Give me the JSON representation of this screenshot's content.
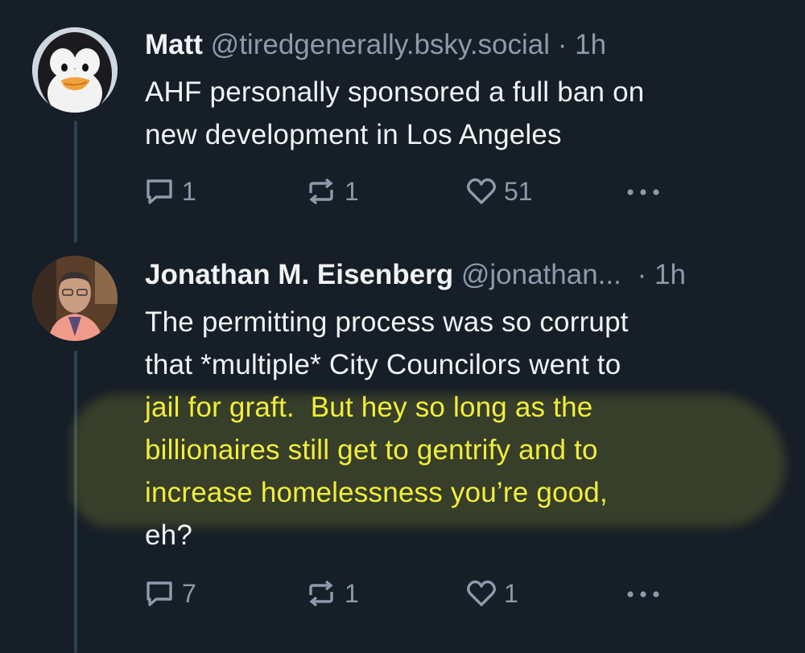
{
  "posts": [
    {
      "author_name": "Matt",
      "handle": "@tiredgenerally.bsky.social",
      "separator": "·",
      "time": "1h",
      "text_lines": [
        "AHF personally sponsored a full ban on",
        "new development in Los Angeles"
      ],
      "replies": "1",
      "reposts": "1",
      "likes": "51"
    },
    {
      "author_name": "Jonathan M. Eisenberg",
      "handle": "@jonathan...",
      "separator": "·",
      "time": "1h",
      "text_lines": [
        "The permitting process was so corrupt",
        "that *multiple* City Councilors went to",
        "jail for graft.  But hey so long as the",
        "billionaires still get to gentrify and to",
        "increase homelessness you’re good,",
        "eh?"
      ],
      "replies": "7",
      "reposts": "1",
      "likes": "1"
    }
  ],
  "colors": {
    "background": "#161e27",
    "text": "#f1f3f5",
    "muted": "#8d9aab",
    "highlight": "#f0ee3c",
    "thread_line": "#2e4052"
  },
  "icons": {
    "reply": "speech-bubble-icon",
    "repost": "repost-arrows-icon",
    "like": "heart-icon",
    "more": "ellipsis-icon"
  }
}
